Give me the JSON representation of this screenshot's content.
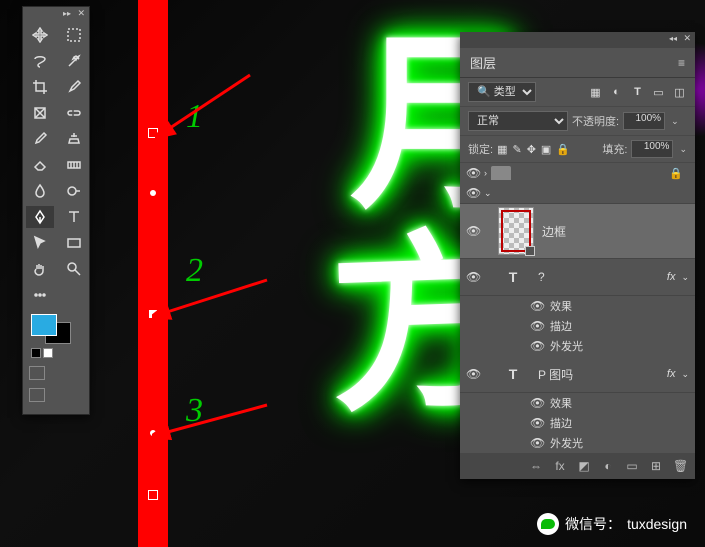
{
  "annotations": {
    "a1": "1",
    "a2": "2",
    "a3": "3"
  },
  "tools": {
    "panel_title": ""
  },
  "layers_panel": {
    "tab": "图层",
    "kind_label": "类型",
    "blend_mode": "正常",
    "opacity_label": "不透明度:",
    "opacity_value": "100%",
    "lock_label": "锁定:",
    "fill_label": "填充:",
    "fill_value": "100%",
    "layers": {
      "bg_name": "边框",
      "text1_name": "?",
      "text2_name": "P 图吗",
      "fx_label": "效果",
      "stroke_label": "描边",
      "outer_glow_label": "外发光"
    }
  },
  "watermark": {
    "label": "微信号：",
    "id": "tuxdesign"
  },
  "icons": {
    "t_icon": "T",
    "fx_icon": "fx",
    "eye": "👁"
  }
}
